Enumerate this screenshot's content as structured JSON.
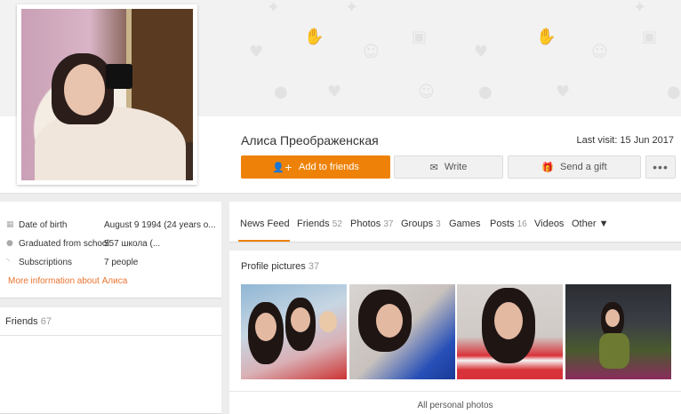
{
  "profile": {
    "name": "Алиса Преображенская",
    "last_visit": "Last visit: 15 Jun 2017"
  },
  "actions": {
    "add_to_friends": "Add to friends",
    "write": "Write",
    "send_gift": "Send a gift",
    "more": "•••"
  },
  "info": {
    "rows": [
      {
        "icon": "calendar-icon",
        "label": "Date of birth",
        "value": "August 9 1994 (24 years o..."
      },
      {
        "icon": "graduation-icon",
        "label": "Graduated from school",
        "value": "557 школа (..."
      },
      {
        "icon": "rss-icon",
        "label": "Subscriptions",
        "value": "7 people"
      }
    ],
    "more_link": "More information about Алиса"
  },
  "friends": {
    "label": "Friends",
    "count": "67"
  },
  "tabs": [
    {
      "label": "News Feed",
      "count": ""
    },
    {
      "label": "Friends",
      "count": "52"
    },
    {
      "label": "Photos",
      "count": "37"
    },
    {
      "label": "Groups",
      "count": "3"
    },
    {
      "label": "Games",
      "count": ""
    },
    {
      "label": "Posts",
      "count": "16"
    },
    {
      "label": "Videos",
      "count": ""
    },
    {
      "label": "Other ▼",
      "count": ""
    }
  ],
  "photos": {
    "title": "Profile pictures",
    "count": "37",
    "all_link": "All personal photos"
  },
  "colors": {
    "accent": "#ee8208",
    "link": "#eb722e"
  }
}
